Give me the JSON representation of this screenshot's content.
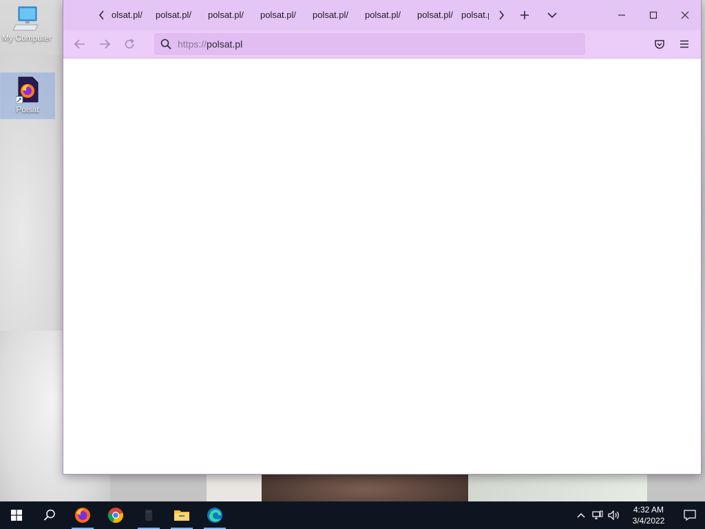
{
  "desktop": {
    "icons": [
      {
        "label": "My Computer",
        "icon": "computer-icon"
      },
      {
        "label": "Polsat",
        "icon": "firefox-shortcut-icon"
      }
    ]
  },
  "browser": {
    "theme_color": "#e5c5f5",
    "tabs": [
      {
        "label": "olsat.pl/"
      },
      {
        "label": "polsat.pl/"
      },
      {
        "label": "polsat.pl/"
      },
      {
        "label": "polsat.pl/"
      },
      {
        "label": "polsat.pl/"
      },
      {
        "label": "polsat.pl/"
      },
      {
        "label": "polsat.pl/"
      },
      {
        "label": "polsat.p"
      }
    ],
    "url": {
      "scheme": "https://",
      "host": "polsat.pl"
    }
  },
  "taskbar": {
    "apps": [
      "start-icon",
      "search-icon",
      "firefox-icon",
      "chrome-icon",
      "app-icon",
      "file-explorer-icon",
      "edge-icon"
    ],
    "clock": {
      "time": "4:32 AM",
      "date": "3/4/2022"
    }
  }
}
